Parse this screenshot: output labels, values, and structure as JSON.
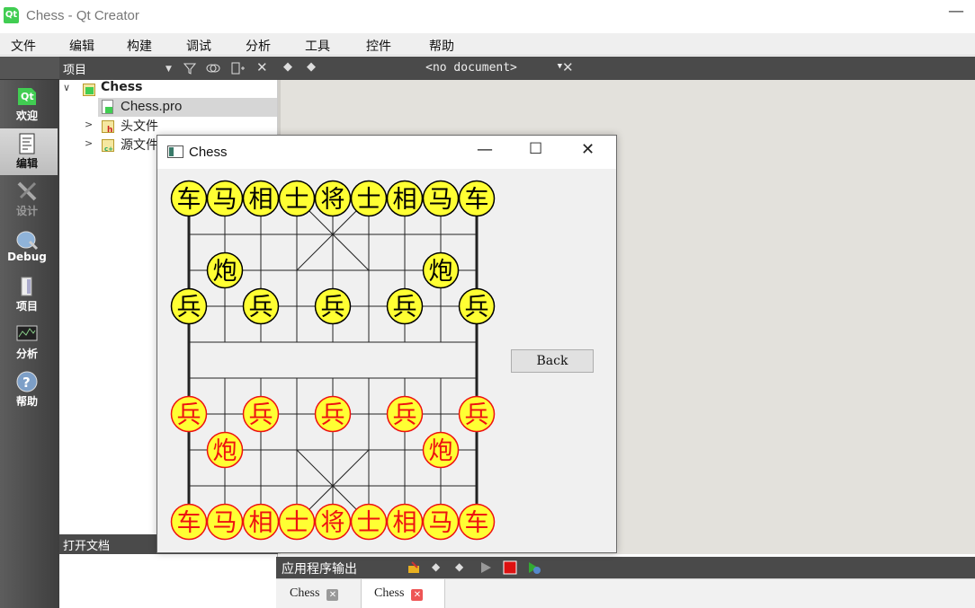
{
  "window": {
    "title": "Chess - Qt Creator",
    "logo_text": "Qt",
    "min_glyph": "—"
  },
  "menu": [
    "文件",
    "编辑",
    "构建",
    "调试",
    "分析",
    "工具",
    "控件",
    "帮助"
  ],
  "modes": [
    {
      "label": "欢迎",
      "icon": "qt-welcome-icon",
      "state": "normal"
    },
    {
      "label": "编辑",
      "icon": "edit-document-icon",
      "state": "active"
    },
    {
      "label": "设计",
      "icon": "design-tools-icon",
      "state": "dim"
    },
    {
      "label": "Debug",
      "icon": "debug-bug-icon",
      "state": "normal"
    },
    {
      "label": "项目",
      "icon": "project-wrench-icon",
      "state": "normal"
    },
    {
      "label": "分析",
      "icon": "analyze-monitor-icon",
      "state": "normal"
    },
    {
      "label": "帮助",
      "icon": "help-question-icon",
      "state": "normal"
    }
  ],
  "project_panel": {
    "title": "项目",
    "tree": [
      {
        "label": "Chess",
        "icon": "qt-project-icon"
      },
      {
        "label": "Chess.pro",
        "icon": "pro-file-icon"
      },
      {
        "label": "头文件",
        "icon": "header-folder-icon"
      },
      {
        "label": "源文件",
        "icon": "source-folder-icon"
      }
    ]
  },
  "open_documents": {
    "title": "打开文档"
  },
  "editor": {
    "document_combo": "<no document>"
  },
  "output": {
    "title": "应用程序输出",
    "tabs": [
      {
        "label": "Chess",
        "selected": false
      },
      {
        "label": "Chess",
        "selected": true
      }
    ]
  },
  "dialog": {
    "title": "Chess",
    "back_label": "Back",
    "colors": {
      "piece_fill": "#ffff33",
      "black_side": "#000000",
      "red_side": "#ee1111",
      "line": "#222222"
    },
    "pieces": [
      {
        "char": "车",
        "side": "black",
        "col": 0,
        "row": 0
      },
      {
        "char": "马",
        "side": "black",
        "col": 1,
        "row": 0
      },
      {
        "char": "相",
        "side": "black",
        "col": 2,
        "row": 0
      },
      {
        "char": "士",
        "side": "black",
        "col": 3,
        "row": 0
      },
      {
        "char": "将",
        "side": "black",
        "col": 4,
        "row": 0
      },
      {
        "char": "士",
        "side": "black",
        "col": 5,
        "row": 0
      },
      {
        "char": "相",
        "side": "black",
        "col": 6,
        "row": 0
      },
      {
        "char": "马",
        "side": "black",
        "col": 7,
        "row": 0
      },
      {
        "char": "车",
        "side": "black",
        "col": 8,
        "row": 0
      },
      {
        "char": "炮",
        "side": "black",
        "col": 1,
        "row": 2
      },
      {
        "char": "炮",
        "side": "black",
        "col": 7,
        "row": 2
      },
      {
        "char": "兵",
        "side": "black",
        "col": 0,
        "row": 3
      },
      {
        "char": "兵",
        "side": "black",
        "col": 2,
        "row": 3
      },
      {
        "char": "兵",
        "side": "black",
        "col": 4,
        "row": 3
      },
      {
        "char": "兵",
        "side": "black",
        "col": 6,
        "row": 3
      },
      {
        "char": "兵",
        "side": "black",
        "col": 8,
        "row": 3
      },
      {
        "char": "兵",
        "side": "red",
        "col": 0,
        "row": 6
      },
      {
        "char": "兵",
        "side": "red",
        "col": 2,
        "row": 6
      },
      {
        "char": "兵",
        "side": "red",
        "col": 4,
        "row": 6
      },
      {
        "char": "兵",
        "side": "red",
        "col": 6,
        "row": 6
      },
      {
        "char": "兵",
        "side": "red",
        "col": 8,
        "row": 6
      },
      {
        "char": "炮",
        "side": "red",
        "col": 1,
        "row": 7
      },
      {
        "char": "炮",
        "side": "red",
        "col": 7,
        "row": 7
      },
      {
        "char": "车",
        "side": "red",
        "col": 0,
        "row": 9
      },
      {
        "char": "马",
        "side": "red",
        "col": 1,
        "row": 9
      },
      {
        "char": "相",
        "side": "red",
        "col": 2,
        "row": 9
      },
      {
        "char": "士",
        "side": "red",
        "col": 3,
        "row": 9
      },
      {
        "char": "将",
        "side": "red",
        "col": 4,
        "row": 9
      },
      {
        "char": "士",
        "side": "red",
        "col": 5,
        "row": 9
      },
      {
        "char": "相",
        "side": "red",
        "col": 6,
        "row": 9
      },
      {
        "char": "马",
        "side": "red",
        "col": 7,
        "row": 9
      },
      {
        "char": "车",
        "side": "red",
        "col": 8,
        "row": 9
      }
    ]
  }
}
